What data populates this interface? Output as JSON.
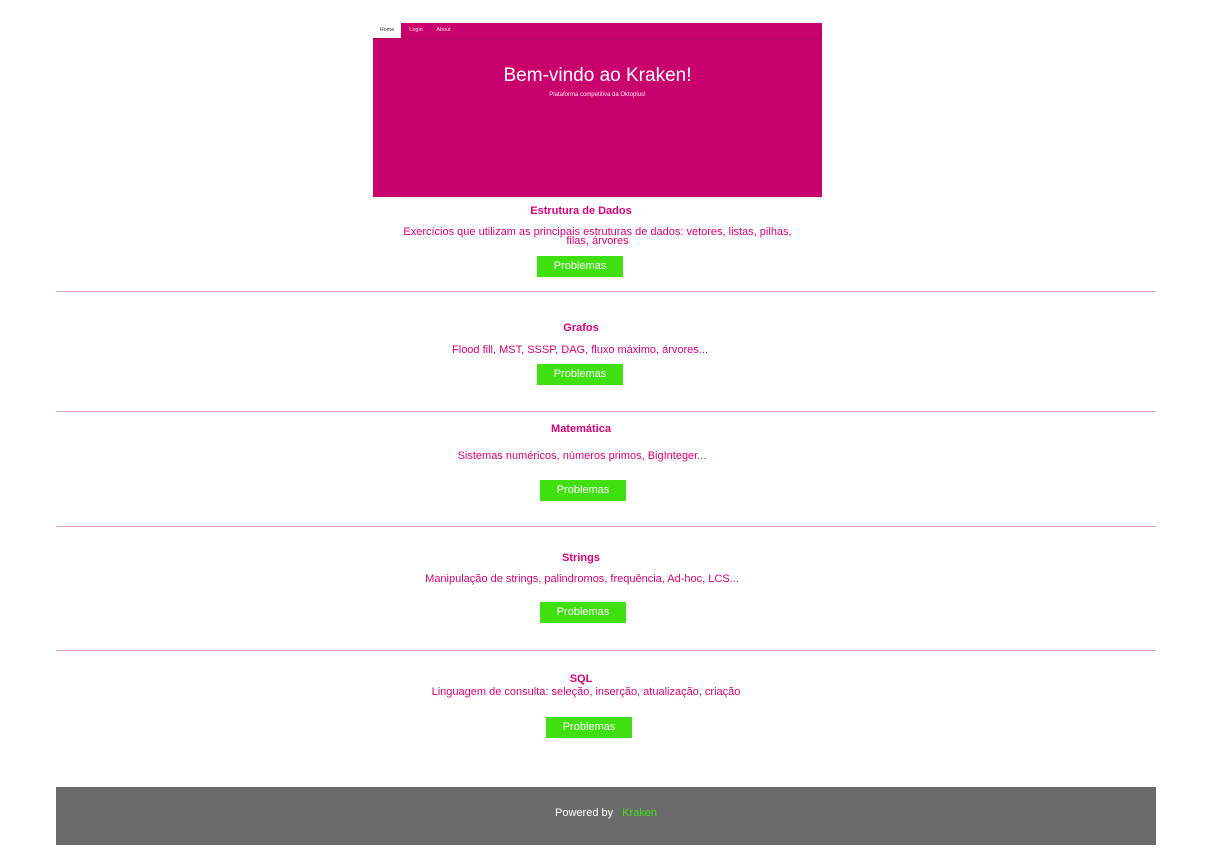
{
  "nav": {
    "items": [
      {
        "label": "Home",
        "active": true
      },
      {
        "label": "Login",
        "active": false
      },
      {
        "label": "About",
        "active": false
      }
    ]
  },
  "hero": {
    "title": "Bem-vindo ao Kraken!",
    "subtitle": "Plataforma competitiva da Oktoplus!"
  },
  "categories": [
    {
      "title": "Estrutura de Dados",
      "description_line1": "Exercícios que utilizam as principais estruturas de dados: vetores, listas, pilhas,",
      "description_line2": "filas, árvores",
      "button": "Problemas"
    },
    {
      "title": "Grafos",
      "description": "Flood fill, MST, SSSP, DAG, fluxo máximo, árvores...",
      "button": "Problemas"
    },
    {
      "title": "Matemática",
      "description": "Sistemas numéricos, números primos, BigInteger...",
      "button": "Problemas"
    },
    {
      "title": "Strings",
      "description": "Manipulação de strings, palindromos, frequência, Ad-hoc, LCS...",
      "button": "Problemas"
    },
    {
      "title": "SQL",
      "description": "Linguagem de consulta: seleção, inserção, atualização, criação",
      "button": "Problemas"
    }
  ],
  "footer": {
    "powered_by": "Powered by",
    "brand": "Kraken"
  },
  "colors": {
    "primary": "#c8016c",
    "text_accent": "#d6037a",
    "button": "#3fdf10",
    "footer_bg": "#6b6b6b"
  }
}
